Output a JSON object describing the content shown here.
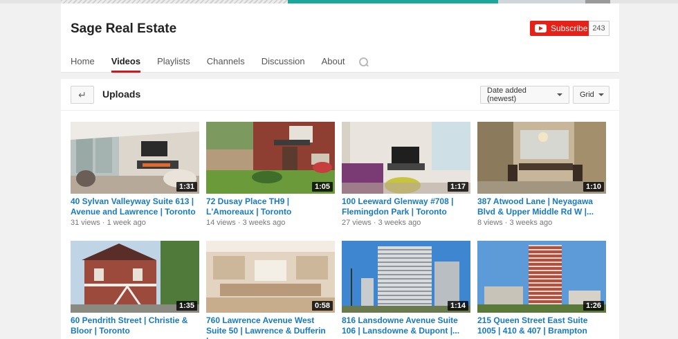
{
  "channel": {
    "title": "Sage Real Estate",
    "subscribe_label": "Subscribe",
    "subscriber_count": "243"
  },
  "tabs": [
    {
      "label": "Home"
    },
    {
      "label": "Videos",
      "active": true
    },
    {
      "label": "Playlists"
    },
    {
      "label": "Channels"
    },
    {
      "label": "Discussion"
    },
    {
      "label": "About"
    }
  ],
  "shelf": {
    "title": "Uploads",
    "sort_label": "Date added (newest)",
    "view_label": "Grid"
  },
  "videos": [
    {
      "title": "40 Sylvan Valleyway Suite 613 | Avenue and Lawrence | Toronto",
      "duration": "1:31",
      "views": "31 views",
      "age": "1 week ago"
    },
    {
      "title": "72 Dusay Place TH9 | L'Amoreaux | Toronto",
      "duration": "1:05",
      "views": "14 views",
      "age": "3 weeks ago"
    },
    {
      "title": "100 Leeward Glenway #708 | Flemingdon Park | Toronto",
      "duration": "1:17",
      "views": "27 views",
      "age": "3 weeks ago"
    },
    {
      "title": "387 Atwood Lane | Neyagawa Blvd & Upper Middle Rd W |...",
      "duration": "1:10",
      "views": "8 views",
      "age": "3 weeks ago"
    },
    {
      "title": "60 Pendrith Street | Christie & Bloor | Toronto",
      "duration": "1:35",
      "views": "",
      "age": ""
    },
    {
      "title": "760 Lawrence Avenue West Suite 50 | Lawrence & Dufferin |...",
      "duration": "0:58",
      "views": "",
      "age": ""
    },
    {
      "title": "816 Lansdowne Avenue Suite 106 | Lansdowne & Dupont |...",
      "duration": "1:14",
      "views": "",
      "age": ""
    },
    {
      "title": "215 Queen Street East Suite 1005 | 410 & 407 | Brampton",
      "duration": "1:26",
      "views": "",
      "age": ""
    }
  ],
  "colors": {
    "accent": "#cc181e",
    "subscribe": "#e62117",
    "link": "#167ac6"
  }
}
